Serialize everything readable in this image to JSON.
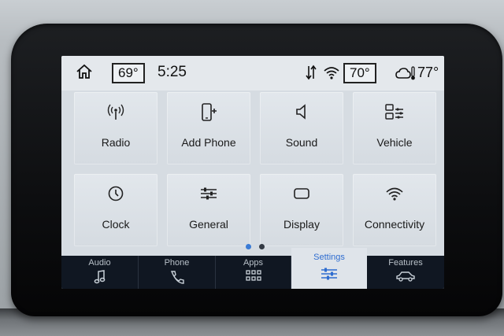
{
  "status_bar": {
    "driver_temp": "69°",
    "time": "5:25",
    "passenger_temp": "70°",
    "outside_temp": "77°",
    "icons": [
      "home-icon",
      "data-transfer-icon",
      "wifi-icon",
      "weather-icon"
    ]
  },
  "tiles": [
    {
      "label": "Radio",
      "icon": "radio-antenna-icon"
    },
    {
      "label": "Add Phone",
      "icon": "add-phone-icon"
    },
    {
      "label": "Sound",
      "icon": "speaker-icon"
    },
    {
      "label": "Vehicle",
      "icon": "vehicle-settings-icon"
    },
    {
      "label": "Clock",
      "icon": "clock-icon"
    },
    {
      "label": "General",
      "icon": "sliders-icon"
    },
    {
      "label": "Display",
      "icon": "display-icon"
    },
    {
      "label": "Connectivity",
      "icon": "wifi-icon"
    }
  ],
  "pagination": {
    "pages": 2,
    "current": 1,
    "active_color": "#3a7bd5",
    "inactive_color": "#333a44"
  },
  "nav": [
    {
      "label": "Audio",
      "icon": "music-note-icon",
      "active": false
    },
    {
      "label": "Phone",
      "icon": "phone-icon",
      "active": false
    },
    {
      "label": "Apps",
      "icon": "apps-grid-icon",
      "active": false
    },
    {
      "label": "Settings",
      "icon": "sliders-icon",
      "active": true
    },
    {
      "label": "Features",
      "icon": "car-icon",
      "active": false
    }
  ],
  "colors": {
    "accent": "#2f6dd0",
    "nav_bg": "#101722",
    "screen_bg": "#d6dce2"
  }
}
